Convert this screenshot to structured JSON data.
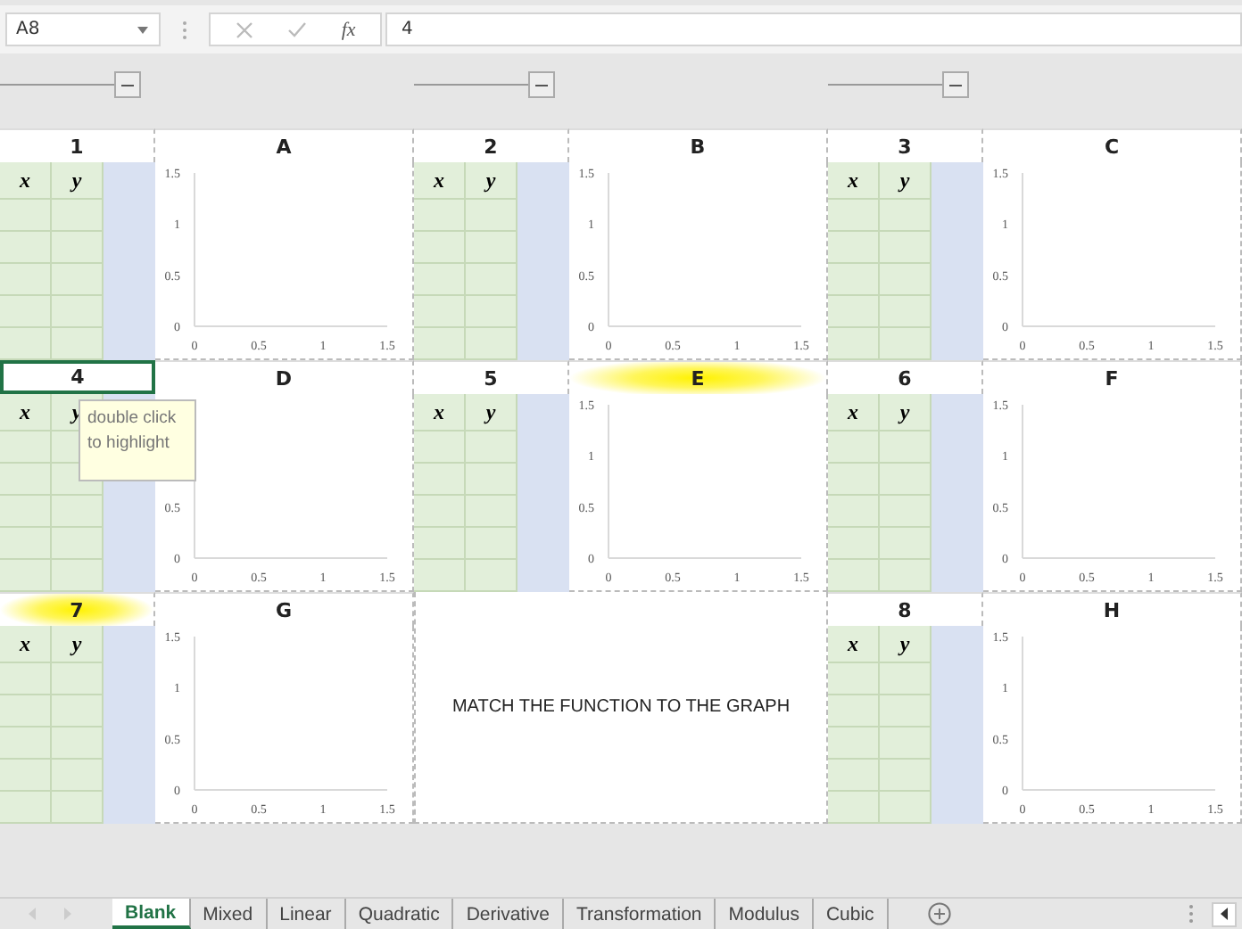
{
  "name_box": "A8",
  "formula_bar": {
    "function_label": "fx",
    "value": "4"
  },
  "sliders": [
    {
      "level": 1
    },
    {
      "level": 1
    },
    {
      "level": 1
    }
  ],
  "blocks": [
    {
      "kind": "pair",
      "number": "1",
      "number_highlighted": false,
      "selected": false,
      "x_label": "x",
      "y_label": "y",
      "letter": "A",
      "letter_highlighted": false,
      "chart_data": {
        "type": "scatter",
        "xlim": [
          0,
          1.5
        ],
        "ylim": [
          0,
          1.5
        ],
        "xticks": [
          0,
          0.5,
          1,
          1.5
        ],
        "yticks": [
          0,
          0.5,
          1,
          1.5
        ]
      }
    },
    {
      "kind": "pair",
      "number": "2",
      "number_highlighted": false,
      "selected": false,
      "x_label": "x",
      "y_label": "y",
      "letter": "B",
      "letter_highlighted": false,
      "chart_data": {
        "type": "scatter",
        "xlim": [
          0,
          1.5
        ],
        "ylim": [
          0,
          1.5
        ],
        "xticks": [
          0,
          0.5,
          1,
          1.5
        ],
        "yticks": [
          0,
          0.5,
          1,
          1.5
        ]
      }
    },
    {
      "kind": "pair",
      "number": "3",
      "number_highlighted": false,
      "selected": false,
      "x_label": "x",
      "y_label": "y",
      "letter": "C",
      "letter_highlighted": false,
      "chart_data": {
        "type": "scatter",
        "xlim": [
          0,
          1.5
        ],
        "ylim": [
          0,
          1.5
        ],
        "xticks": [
          0,
          0.5,
          1,
          1.5
        ],
        "yticks": [
          0,
          0.5,
          1,
          1.5
        ]
      }
    },
    {
      "kind": "pair",
      "number": "4",
      "number_highlighted": false,
      "selected": true,
      "x_label": "x",
      "y_label": "y",
      "letter": "D",
      "letter_highlighted": false,
      "tooltip": "double click to highlight",
      "chart_data": {
        "type": "scatter",
        "xlim": [
          0,
          1.5
        ],
        "ylim": [
          0,
          1.5
        ],
        "xticks": [
          0,
          0.5,
          1,
          1.5
        ],
        "yticks": [
          0,
          0.5
        ]
      }
    },
    {
      "kind": "pair",
      "number": "5",
      "number_highlighted": false,
      "selected": false,
      "x_label": "x",
      "y_label": "y",
      "letter": "E",
      "letter_highlighted": true,
      "chart_data": {
        "type": "scatter",
        "xlim": [
          0,
          1.5
        ],
        "ylim": [
          0,
          1.5
        ],
        "xticks": [
          0,
          0.5,
          1,
          1.5
        ],
        "yticks": [
          0,
          0.5,
          1,
          1.5
        ]
      }
    },
    {
      "kind": "pair",
      "number": "6",
      "number_highlighted": false,
      "selected": false,
      "x_label": "x",
      "y_label": "y",
      "letter": "F",
      "letter_highlighted": false,
      "chart_data": {
        "type": "scatter",
        "xlim": [
          0,
          1.5
        ],
        "ylim": [
          0,
          1.5
        ],
        "xticks": [
          0,
          0.5,
          1,
          1.5
        ],
        "yticks": [
          0,
          0.5,
          1,
          1.5
        ]
      }
    },
    {
      "kind": "pair",
      "number": "7",
      "number_highlighted": true,
      "selected": false,
      "x_label": "x",
      "y_label": "y",
      "letter": "G",
      "letter_highlighted": false,
      "chart_data": {
        "type": "scatter",
        "xlim": [
          0,
          1.5
        ],
        "ylim": [
          0,
          1.5
        ],
        "xticks": [
          0,
          0.5,
          1,
          1.5
        ],
        "yticks": [
          0,
          0.5,
          1,
          1.5
        ]
      }
    },
    {
      "kind": "message",
      "text": "MATCH THE FUNCTION TO THE GRAPH"
    },
    {
      "kind": "pair",
      "number": "8",
      "number_highlighted": false,
      "selected": false,
      "x_label": "x",
      "y_label": "y",
      "letter": "H",
      "letter_highlighted": false,
      "chart_data": {
        "type": "scatter",
        "xlim": [
          0,
          1.5
        ],
        "ylim": [
          0,
          1.5
        ],
        "xticks": [
          0,
          0.5,
          1,
          1.5
        ],
        "yticks": [
          0,
          0.5,
          1,
          1.5
        ]
      }
    }
  ],
  "sheet_tabs": [
    {
      "label": "Blank",
      "selected": true
    },
    {
      "label": "Mixed",
      "selected": false
    },
    {
      "label": "Linear",
      "selected": false
    },
    {
      "label": "Quadratic",
      "selected": false
    },
    {
      "label": "Derivative",
      "selected": false
    },
    {
      "label": "Transformation",
      "selected": false
    },
    {
      "label": "Modulus",
      "selected": false
    },
    {
      "label": "Cubic",
      "selected": false
    }
  ]
}
